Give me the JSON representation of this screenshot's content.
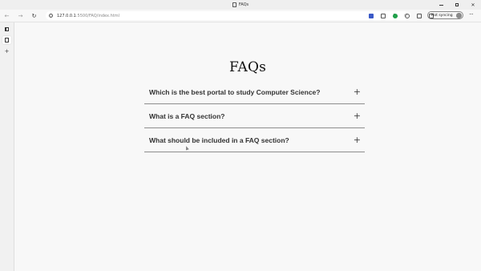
{
  "browser": {
    "tab_title": "FAQs",
    "url_host": "127.0.0.1",
    "url_rest": ":5500/FAQ/index.html",
    "profile_label": "Not syncing",
    "reader_label": "Aᴀ"
  },
  "icons": {
    "back": "back-arrow-icon",
    "forward": "forward-arrow-icon",
    "refresh": "refresh-icon",
    "info": "site-info-icon",
    "favorite": "star-icon",
    "more": "more-icon",
    "new_tab": "plus-icon"
  },
  "page": {
    "title": "FAQs",
    "faqs": [
      {
        "question": "Which is the best portal to study Computer Science?",
        "toggle": "+"
      },
      {
        "question": "What is a FAQ section?",
        "toggle": "+"
      },
      {
        "question": "What should be included in a FAQ section?",
        "toggle": "+"
      }
    ]
  },
  "colors": {
    "divider": "#8e8e8e",
    "question_text": "#333333",
    "title_text": "#111111"
  }
}
